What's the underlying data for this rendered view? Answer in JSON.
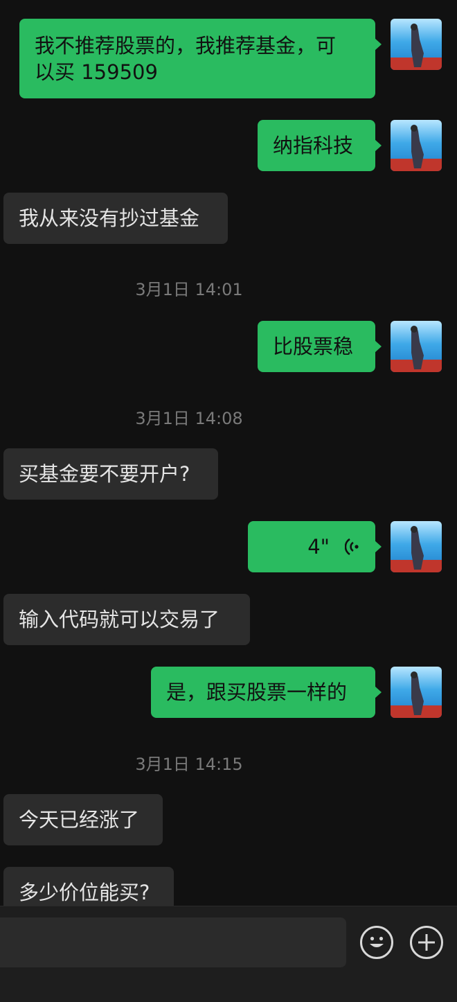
{
  "messages": [
    {
      "text": "我不推荐股票的，我推荐基金，可以买 159509",
      "line1": "我不推荐股票的，我推荐基金，可",
      "line2": "以买 159509"
    },
    {
      "text": "纳指科技"
    },
    {
      "text": "我从来没有抄过基金"
    },
    {
      "time": "3月1日 14:01"
    },
    {
      "text": "比股票稳"
    },
    {
      "time": "3月1日 14:08"
    },
    {
      "text": "买基金要不要开户?"
    },
    {
      "voice_duration": "4\""
    },
    {
      "text": "输入代码就可以交易了"
    },
    {
      "text": "是，跟买股票一样的"
    },
    {
      "time": "3月1日 14:15"
    },
    {
      "text": "今天已经涨了"
    },
    {
      "text": "多少价位能买?"
    }
  ],
  "colors": {
    "outgoing_bubble": "#2ABB60",
    "incoming_bubble": "#2C2C2C",
    "background": "#111111"
  },
  "icons": {
    "emoji": "emoji-icon",
    "add": "plus-icon",
    "voice": "voice-wave-icon"
  }
}
